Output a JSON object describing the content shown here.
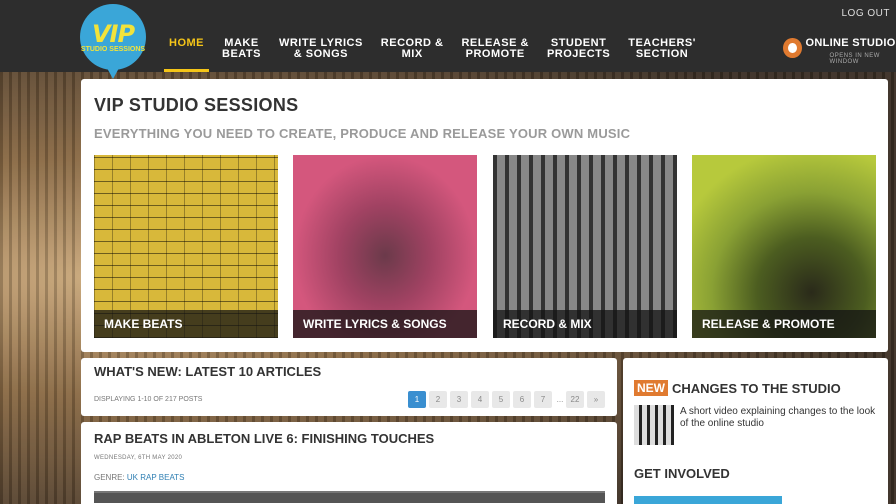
{
  "header": {
    "logo": {
      "main": "VIP",
      "sub": "STUDIO SESSIONS"
    },
    "nav": [
      {
        "label": "HOME"
      },
      {
        "label": "MAKE\nBEATS"
      },
      {
        "label": "WRITE LYRICS\n& SONGS"
      },
      {
        "label": "RECORD &\nMIX"
      },
      {
        "label": "RELEASE &\nPROMOTE"
      },
      {
        "label": "STUDENT\nPROJECTS"
      },
      {
        "label": "TEACHERS'\nSECTION"
      }
    ],
    "logout": "LOG OUT",
    "online": {
      "label": "ONLINE STUDIO",
      "note": "OPENS IN NEW WINDOW"
    }
  },
  "hero": {
    "title": "VIP STUDIO SESSIONS",
    "subtitle": "EVERYTHING YOU NEED TO CREATE, PRODUCE AND RELEASE YOUR OWN MUSIC",
    "tiles": [
      {
        "label": "MAKE BEATS"
      },
      {
        "label": "WRITE LYRICS & SONGS"
      },
      {
        "label": "RECORD & MIX"
      },
      {
        "label": "RELEASE & PROMOTE"
      }
    ]
  },
  "articles": {
    "heading": "WHAT'S NEW: LATEST 10 ARTICLES",
    "displaying": "DISPLAYING 1-10 OF 217 POSTS",
    "pages": [
      "1",
      "2",
      "3",
      "4",
      "5",
      "6",
      "7",
      "...",
      "22",
      "»"
    ],
    "current_page": 1
  },
  "post": {
    "title": "RAP BEATS IN ABLETON LIVE 6: FINISHING TOUCHES",
    "date": "WEDNESDAY, 6TH MAY 2020",
    "genre_label": "GENRE:",
    "genre": "UK RAP BEATS"
  },
  "sidebar": {
    "badge": "NEW",
    "heading": "CHANGES TO THE STUDIO",
    "description": "A short video explaining changes to the look of the online studio",
    "get_involved": "GET INVOLVED"
  },
  "colors": {
    "accent": "#f5c518",
    "brand_blue": "#3aa6d8",
    "orange": "#e07a30",
    "link": "#2f7fb3"
  }
}
